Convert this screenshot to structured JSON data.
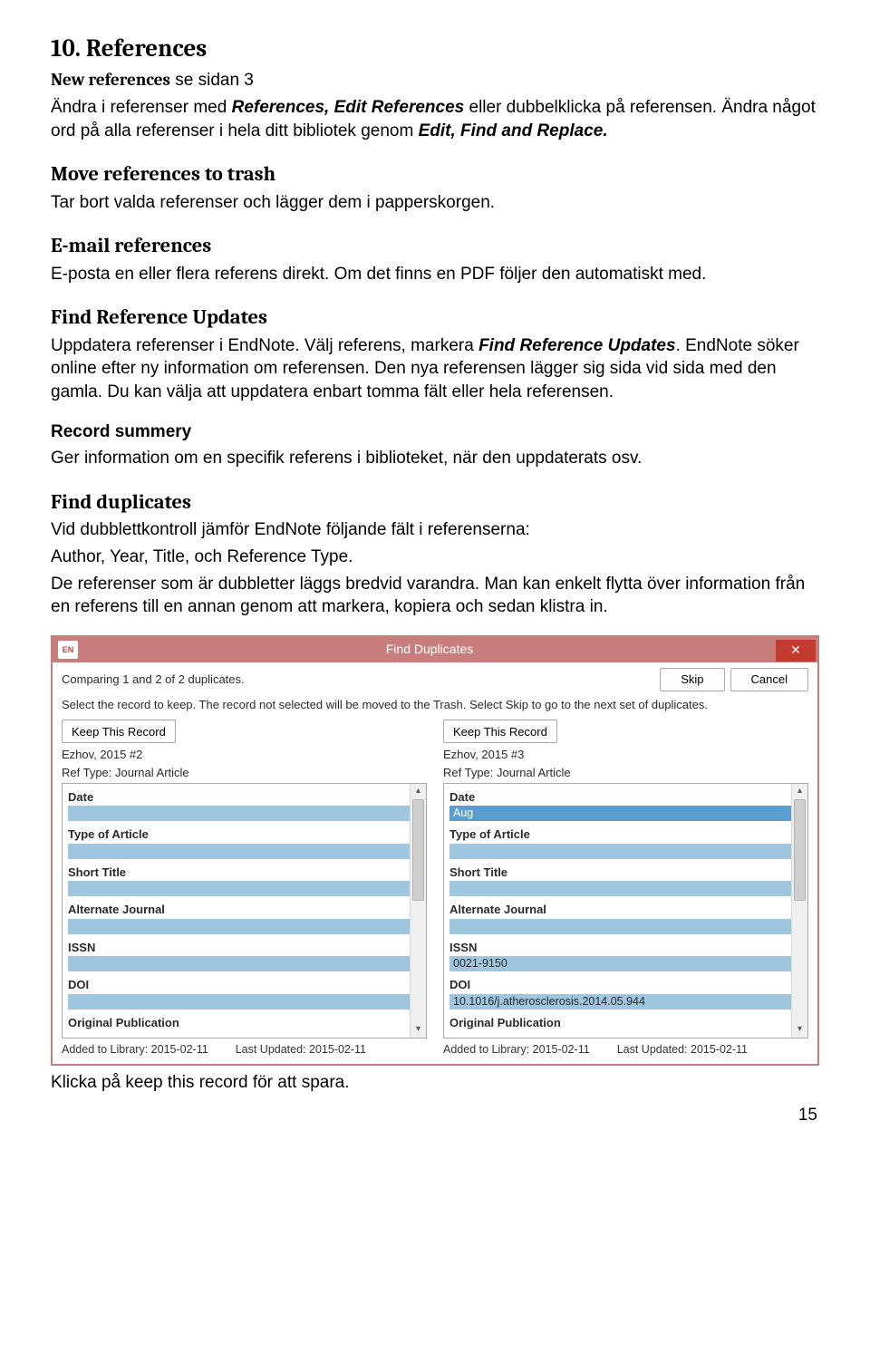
{
  "doc": {
    "h1": "10. References",
    "p1a": "New references",
    "p1b": " se sidan 3",
    "p2a": "Ändra i referenser med ",
    "p2b": "References, Edit References",
    "p2c": " eller dubbelklicka på referensen. Ändra något ord på alla referenser i hela ditt bibliotek genom ",
    "p2d": "Edit, Find and Replace.",
    "h2": "Move references to trash",
    "p3": "Tar bort valda referenser och lägger dem i papperskorgen.",
    "h3": "E-mail references",
    "p4": "E-posta en eller flera referens direkt. Om det finns en PDF följer den automatiskt med.",
    "h4": "Find Reference Updates",
    "p5a": "Uppdatera referenser i EndNote. Välj referens, markera ",
    "p5b": "Find Reference Updates",
    "p5c": ". EndNote söker online efter ny information om referensen. Den nya referensen lägger sig sida vid sida med den gamla. Du kan välja att uppdatera enbart tomma fält eller hela referensen.",
    "h5": "Record summery",
    "p6": "Ger information om en specifik referens i biblioteket, när den uppdaterats osv.",
    "h6": "Find duplicates",
    "p7": "Vid dubblettkontroll jämför EndNote följande fält i referenserna:",
    "p8": "Author, Year, Title, och Reference Type.",
    "p9": "De referenser som är dubbletter läggs bredvid varandra. Man kan enkelt flytta över information från en referens till en annan genom att markera, kopiera och sedan klistra in.",
    "after": "Klicka på keep this record för att spara.",
    "pagenum": "15"
  },
  "dialog": {
    "appicon": "EN",
    "title": "Find Duplicates",
    "close": "✕",
    "comparing": "Comparing 1 and 2 of 2 duplicates.",
    "skip": "Skip",
    "cancel": "Cancel",
    "instruction": "Select the record to keep. The record not selected will be moved to the Trash. Select Skip to go to the next set of duplicates.",
    "keep": "Keep This Record",
    "left": {
      "id": "Ezhov, 2015 #2",
      "reftype": "Ref Type: Journal Article",
      "fields": {
        "date": {
          "label": "Date",
          "value": ""
        },
        "type": {
          "label": "Type of Article",
          "value": ""
        },
        "short": {
          "label": "Short Title",
          "value": ""
        },
        "alt": {
          "label": "Alternate Journal",
          "value": ""
        },
        "issn": {
          "label": "ISSN",
          "value": ""
        },
        "doi": {
          "label": "DOI",
          "value": ""
        },
        "orig": {
          "label": "Original Publication",
          "value": ""
        }
      },
      "added": "Added to Library: 2015-02-11",
      "updated": "Last Updated: 2015-02-11"
    },
    "right": {
      "id": "Ezhov, 2015 #3",
      "reftype": "Ref Type: Journal Article",
      "fields": {
        "date": {
          "label": "Date",
          "value": "Aug"
        },
        "type": {
          "label": "Type of Article",
          "value": ""
        },
        "short": {
          "label": "Short Title",
          "value": ""
        },
        "alt": {
          "label": "Alternate Journal",
          "value": ""
        },
        "issn": {
          "label": "ISSN",
          "value": "0021-9150"
        },
        "doi": {
          "label": "DOI",
          "value": "10.1016/j.atherosclerosis.2014.05.944"
        },
        "orig": {
          "label": "Original Publication",
          "value": ""
        }
      },
      "added": "Added to Library: 2015-02-11",
      "updated": "Last Updated: 2015-02-11"
    }
  }
}
